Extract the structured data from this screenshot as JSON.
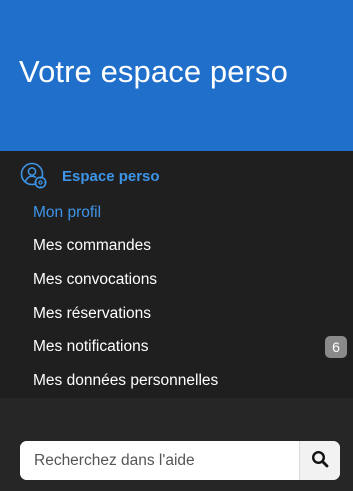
{
  "header": {
    "title": "Votre espace perso"
  },
  "section": {
    "title": "Espace perso",
    "icon": "user-settings-icon"
  },
  "menu": {
    "items": [
      {
        "label": "Mon profil",
        "active": true
      },
      {
        "label": "Mes commandes",
        "active": false
      },
      {
        "label": "Mes convocations",
        "active": false
      },
      {
        "label": "Mes réservations",
        "active": false
      },
      {
        "label": "Mes notifications",
        "active": false,
        "badge": "6"
      },
      {
        "label": "Mes données personnelles",
        "active": false
      }
    ]
  },
  "search": {
    "placeholder": "Recherchez dans l'aide",
    "icon": "search-icon"
  },
  "colors": {
    "header_bg": "#1f6fcb",
    "accent": "#3d95e8",
    "panel_bg": "#1f1f1f",
    "page_bg": "#262626",
    "badge_bg": "#8a8a8a"
  }
}
